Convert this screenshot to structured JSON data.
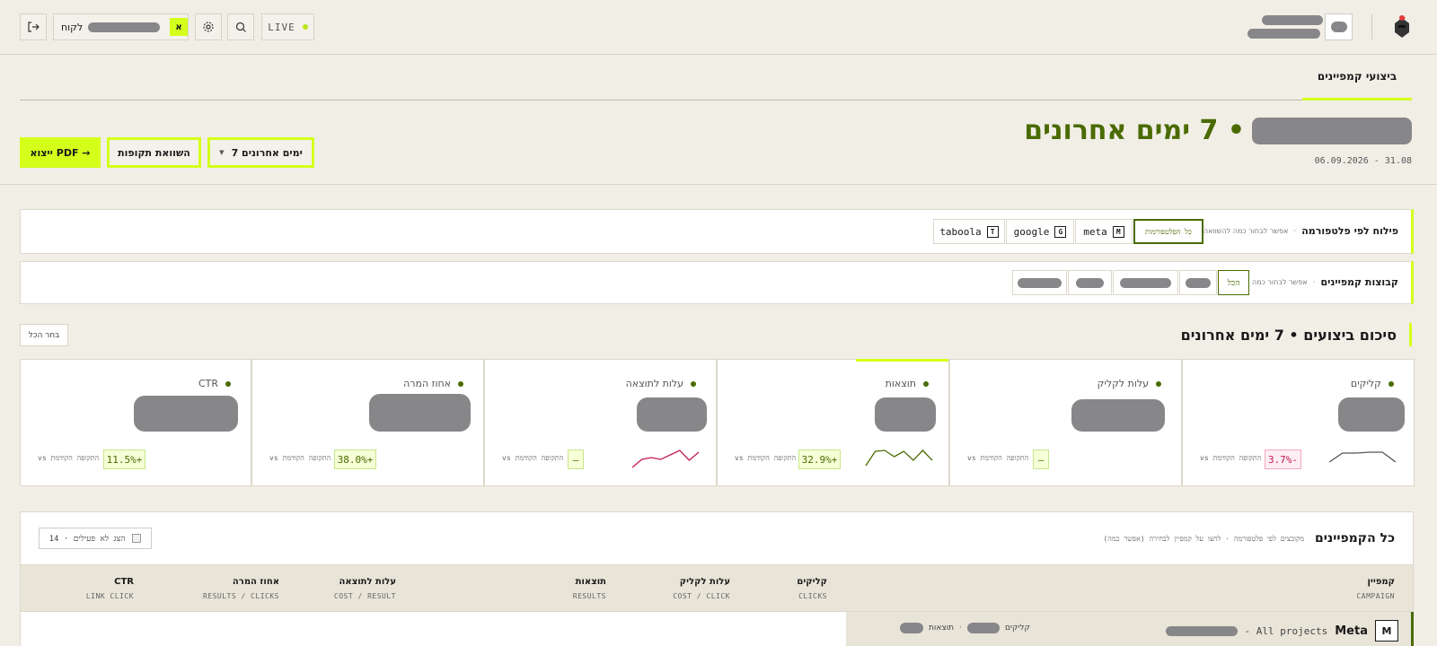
{
  "topbar": {
    "live_label": "LIVE",
    "client_label": "לקוח",
    "client_badge": "א"
  },
  "tabs": {
    "active": "ביצועי קמפיינים"
  },
  "hero": {
    "title_suffix": "• 7 ימים אחרונים",
    "date_range": "06.09.2026 - 31.08",
    "range_select": "7 ימים אחרונים",
    "compare_button": "השוואת תקופות",
    "export_button": "ייצוא PDF →"
  },
  "platform_filter": {
    "title": "פילוח לפי פלטפורמה",
    "hint": "אפשר לבחור כמה להשוואה",
    "chips": [
      {
        "label": "כל הפלטפורמות",
        "logo": ""
      },
      {
        "label": "meta",
        "logo": "M"
      },
      {
        "label": "google",
        "logo": "G"
      },
      {
        "label": "taboola",
        "logo": "T"
      }
    ]
  },
  "campaign_groups": {
    "title": "קבוצות קמפיינים",
    "hint": "אפשר לבחור כמה",
    "all_label": "הכל"
  },
  "summary": {
    "title": "סיכום ביצועים • 7 ימים אחרונים",
    "select_all": "בחר הכל",
    "vs_label": "vs התקופה הקודמת",
    "kpis": [
      {
        "label": "קליקים",
        "delta": "3.7%-",
        "delta_type": "negative",
        "spark": [
          14,
          4,
          4,
          3,
          3,
          14
        ],
        "spark_color": "#555555"
      },
      {
        "label": "עלות לקליק",
        "delta": "—",
        "delta_type": "neutral",
        "spark": [],
        "spark_color": ""
      },
      {
        "label": "תוצאות",
        "delta": "32.9%+",
        "delta_type": "positive",
        "spark": [
          18,
          2,
          1,
          8,
          2,
          12,
          1,
          12
        ],
        "spark_color": "#4a6b00"
      },
      {
        "label": "עלות לתוצאה",
        "delta": "—",
        "delta_type": "neutral",
        "spark": [
          20,
          11,
          9,
          11,
          6,
          1,
          12,
          3
        ],
        "spark_color": "#c2185b"
      },
      {
        "label": "אחוז המרה",
        "delta": "38.0%+",
        "delta_type": "positive",
        "spark": [],
        "spark_color": ""
      },
      {
        "label": "CTR",
        "delta": "11.5%+",
        "delta_type": "positive",
        "spark": [],
        "spark_color": ""
      }
    ]
  },
  "campaigns": {
    "title": "כל הקמפיינים",
    "hint": "מקובצים לפי פלטפורמה · לחצו על קמפיין לבחירה (אפשר כמה)",
    "show_inactive": "הצג לא פעילים · 14",
    "columns": [
      {
        "title": "קמפיין",
        "sub": "CAMPAIGN"
      },
      {
        "title": "קליקים",
        "sub": "CLICKS"
      },
      {
        "title": "עלות לקליק",
        "sub": "COST / CLICK"
      },
      {
        "title": "תוצאות",
        "sub": "RESULTS"
      },
      {
        "title": "עלות לתוצאה",
        "sub": "COST / RESULT"
      },
      {
        "title": "אחוז המרה",
        "sub": "RESULTS / CLICKS"
      },
      {
        "title": "CTR",
        "sub": "LINK CLICK"
      }
    ],
    "group_row": {
      "platform": "Meta",
      "logo": "M",
      "projects": "- All projects",
      "clicks_label": "קליקים",
      "results_label": "תוצאות"
    }
  },
  "colors": {
    "accent": "#d4ff1a",
    "olive": "#4a6b00",
    "background": "#f1eee6",
    "negative": "#c2185b"
  }
}
